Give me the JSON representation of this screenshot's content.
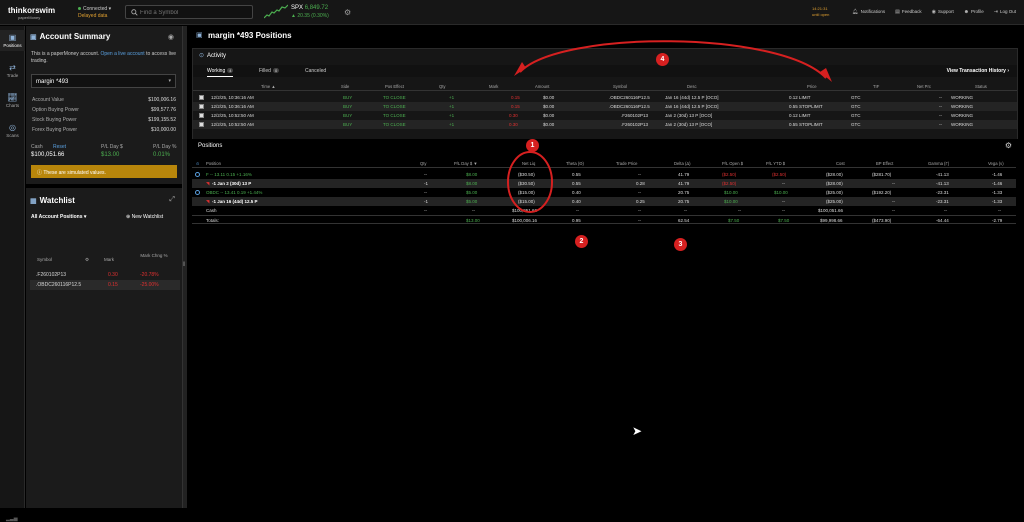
{
  "topbar": {
    "logo": "thinkorswim",
    "logo_sub": "paperMoney",
    "connection": "Connected",
    "connection_sub": "Delayed data",
    "search_placeholder": "Find a Symbol",
    "spx_symbol": "SPX",
    "spx_value": "6,849.72",
    "spx_change": "▲ 20.35 (0.30%)",
    "clock_time": "14:21:31",
    "clock_sub": "until open",
    "nav": [
      {
        "icon": "bell-icon",
        "label": "Notifications"
      },
      {
        "icon": "feedback-icon",
        "label": "Feedback"
      },
      {
        "icon": "support-icon",
        "label": "Support"
      },
      {
        "icon": "profile-icon",
        "label": "Profile"
      },
      {
        "icon": "logout-icon",
        "label": "Log Out"
      }
    ]
  },
  "leftnav": [
    {
      "icon": "positions-icon",
      "label": "Positions"
    },
    {
      "icon": "trade-icon",
      "label": "Trade"
    },
    {
      "icon": "charts-icon",
      "label": "Charts"
    },
    {
      "icon": "scans-icon",
      "label": "Scans"
    }
  ],
  "account": {
    "title": "Account Summary",
    "paper_text": "This is a paperMoney account.",
    "paper_link": "Open a live account",
    "paper_text2": "to access live trading.",
    "account_name": "margin *493",
    "rows": [
      {
        "k": "Account Value",
        "v": "$100,006.16"
      },
      {
        "k": "Option Buying Power",
        "v": "$99,577.76"
      },
      {
        "k": "Stock Buying Power",
        "v": "$199,155.52"
      },
      {
        "k": "Forex Buying Power",
        "v": "$10,000.00"
      }
    ],
    "cash_label": "Cash",
    "reset_label": "Reset",
    "pl_day_label": "P/L Day $",
    "pl_day_pct_label": "P/L Day %",
    "cash_value": "$100,051.66",
    "pl_day_value": "$13.00",
    "pl_day_pct_value": "0.01%",
    "warning": "These are simulated values."
  },
  "watchlist": {
    "title": "Watchlist",
    "selector": "All Account Positions",
    "new_label": "New Watchlist",
    "headers": {
      "symbol": "Symbol",
      "mark": "Mark",
      "chg": "Mark Chng %"
    },
    "rows": [
      {
        "symbol": ".F260102P13",
        "mark": "0.30",
        "chg": "-20.78%"
      },
      {
        "symbol": ".OBDC260116P12.5",
        "mark": "0.15",
        "chg": "-25.00%"
      }
    ]
  },
  "main": {
    "title": "margin *493 Positions",
    "activity": {
      "title": "Activity",
      "tabs": [
        {
          "label": "Working",
          "count": "4"
        },
        {
          "label": "Filled",
          "count": "0"
        },
        {
          "label": "Canceled",
          "count": ""
        }
      ],
      "view_history": "View Transaction History ›",
      "headers": [
        "Time ▲",
        "Side",
        "Pos Effect",
        "Qty",
        "Mark",
        "Amount",
        "Symbol",
        "Desc",
        "Price",
        "TIF",
        "Net Prc",
        "Status"
      ],
      "rows": [
        {
          "time": "12/2/25, 10:36:16 AM",
          "side": "BUY",
          "pos": "TO CLOSE",
          "qty": "+1",
          "mark": "0.15",
          "amount": "$0.00",
          "symbol": ".OBDC260116P12.5",
          "desc": "Jan 16 (44d) 12.5 P [OCO]",
          "price": "0.12 LIMIT",
          "tif": "GTC",
          "net": "--",
          "status": "WORKING"
        },
        {
          "time": "12/2/25, 10:36:16 AM",
          "side": "BUY",
          "pos": "TO CLOSE",
          "qty": "+1",
          "mark": "0.15",
          "amount": "$0.00",
          "symbol": ".OBDC260116P12.5",
          "desc": "Jan 16 (44d) 12.5 P [OCO]",
          "price": "0.55 STOPLIMIT",
          "tif": "GTC",
          "net": "--",
          "status": "WORKING"
        },
        {
          "time": "12/2/25, 10:52:50 AM",
          "side": "BUY",
          "pos": "TO CLOSE",
          "qty": "+1",
          "mark": "0.30",
          "amount": "$0.00",
          "symbol": ".F260102P13",
          "desc": "Jan 2 (30d) 13 P [OCO]",
          "price": "0.12 LIMIT",
          "tif": "GTC",
          "net": "--",
          "status": "WORKING"
        },
        {
          "time": "12/2/25, 10:52:50 AM",
          "side": "BUY",
          "pos": "TO CLOSE",
          "qty": "+1",
          "mark": "0.30",
          "amount": "$0.00",
          "symbol": ".F260102P13",
          "desc": "Jan 2 (30d) 13 P [OCO]",
          "price": "0.55 STOPLIMIT",
          "tif": "GTC",
          "net": "--",
          "status": "WORKING"
        }
      ]
    },
    "positions": {
      "title": "Positions",
      "headers": [
        "Position",
        "Qty",
        "P/L Day $ ▼",
        "Net Liq",
        "Theta (Θ)",
        "Trade Price",
        "Delta (Δ)",
        "P/L Open $",
        "P/L YTD $",
        "Cost",
        "BP Effect",
        "Gamma (Γ)",
        "Vega (ν)"
      ],
      "rows": [
        {
          "pos": "F -- 13.11 0.15 +1.16%",
          "qty": "--",
          "pl_day": "$8.00",
          "net_liq": "($30.50)",
          "theta": "0.55",
          "trade": "--",
          "delta": "41.79",
          "pl_open": "($2.50)",
          "pl_ytd": "($2.50)",
          "cost": "($28.00)",
          "bp": "($281.70)",
          "gamma": "-41.13",
          "vega": "-1.46",
          "kind": "parent"
        },
        {
          "pos": "-1 Jan 2 (30d) 13 P",
          "qty": "-1",
          "pl_day": "$8.00",
          "net_liq": "($30.50)",
          "theta": "0.55",
          "trade": "0.28",
          "delta": "41.79",
          "pl_open": "($2.50)",
          "pl_ytd": "--",
          "cost": "($28.00)",
          "bp": "--",
          "gamma": "-41.13",
          "vega": "-1.46",
          "kind": "child"
        },
        {
          "pos": "OBDC -- 13.41 0.19 +1.44%",
          "qty": "--",
          "pl_day": "$5.00",
          "net_liq": "($15.00)",
          "theta": "0.40",
          "trade": "--",
          "delta": "20.75",
          "pl_open": "$10.00",
          "pl_ytd": "$10.00",
          "cost": "($25.00)",
          "bp": "($192.20)",
          "gamma": "-23.31",
          "vega": "-1.33",
          "kind": "parent"
        },
        {
          "pos": "-1 Jan 16 (44d) 12.5 P",
          "qty": "-1",
          "pl_day": "$5.00",
          "net_liq": "($15.00)",
          "theta": "0.40",
          "trade": "0.25",
          "delta": "20.75",
          "pl_open": "$10.00",
          "pl_ytd": "--",
          "cost": "($25.00)",
          "bp": "--",
          "gamma": "-23.31",
          "vega": "-1.33",
          "kind": "child"
        },
        {
          "pos": "Cash",
          "qty": "--",
          "pl_day": "--",
          "net_liq": "$100,051.66",
          "theta": "--",
          "trade": "--",
          "delta": "--",
          "pl_open": "--",
          "pl_ytd": "--",
          "cost": "$100,051.66",
          "bp": "--",
          "gamma": "--",
          "vega": "--",
          "kind": "cash"
        },
        {
          "pos": "Totals:",
          "qty": "",
          "pl_day": "$13.00",
          "net_liq": "$100,006.16",
          "theta": "0.95",
          "trade": "--",
          "delta": "62.54",
          "pl_open": "$7.50",
          "pl_ytd": "$7.50",
          "cost": "$99,998.66",
          "bp": "($473.90)",
          "gamma": "-64.44",
          "vega": "-2.79",
          "kind": "total"
        }
      ]
    }
  },
  "annotations": [
    "1",
    "2",
    "3",
    "4"
  ],
  "colors": {
    "accent": "#5aa0e0",
    "gain": "#4caf50",
    "loss": "#e03030",
    "warning": "#b8860b",
    "annotation": "#d62020"
  }
}
